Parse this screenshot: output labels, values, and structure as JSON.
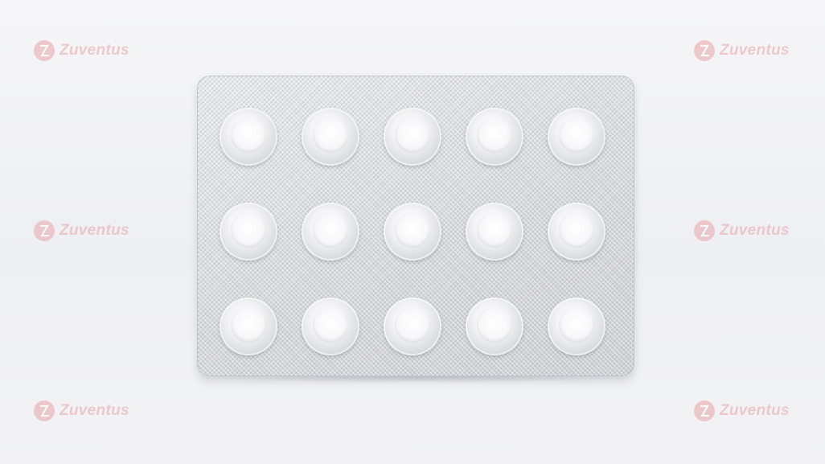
{
  "watermark": {
    "brand_text": "Zuventus",
    "logo_icon": "zuventus-logo-icon",
    "color": "#e8a4a8"
  },
  "blister_pack": {
    "rows": 3,
    "columns": 5,
    "tablet_count": 15,
    "foil_color": "#dcdde1",
    "tablet_color": "#f4f4f6"
  },
  "background_color": "#f3f3f6"
}
